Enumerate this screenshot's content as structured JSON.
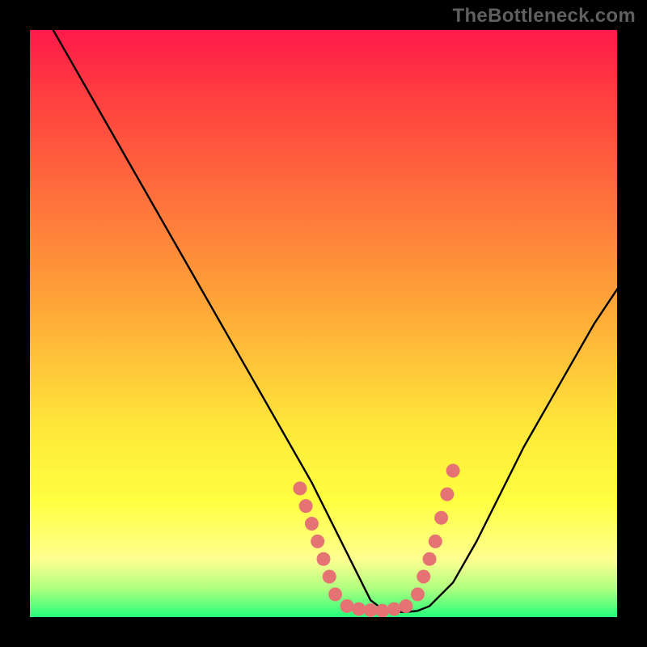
{
  "watermark": "TheBottleneck.com",
  "colors": {
    "background": "#000000",
    "gradient_top": "#ff194a",
    "gradient_red": "#ff4040",
    "gradient_orange": "#ffa038",
    "gradient_yellow_top": "#ffe83a",
    "gradient_yellow": "#ffff40",
    "gradient_pale_yellow": "#ffff90",
    "gradient_pale_green": "#b0ff80",
    "gradient_green": "#20ff7a",
    "curve": "#000000",
    "dots": "#e57373",
    "border": "#000000"
  },
  "chart_data": {
    "type": "line",
    "title": "",
    "xlabel": "",
    "ylabel": "",
    "xlim": [
      0,
      100
    ],
    "ylim": [
      0,
      100
    ],
    "series": [
      {
        "name": "bottleneck-curve",
        "x": [
          4,
          8,
          12,
          16,
          20,
          24,
          28,
          32,
          36,
          40,
          44,
          48,
          50,
          52,
          54,
          56,
          58,
          60,
          62,
          64,
          66,
          68,
          72,
          76,
          80,
          84,
          88,
          92,
          96,
          100
        ],
        "y": [
          100,
          93,
          86,
          79,
          72,
          65,
          58,
          51,
          44,
          37,
          30,
          23,
          19,
          15,
          11,
          7,
          3,
          1.5,
          1,
          1,
          1.2,
          2,
          6,
          13,
          21,
          29,
          36,
          43,
          50,
          56
        ]
      }
    ],
    "dots": {
      "left_cluster": {
        "x": [
          46,
          47,
          48,
          49,
          50,
          51,
          52
        ],
        "y": [
          22,
          19,
          16,
          13,
          10,
          7,
          4
        ]
      },
      "valley": {
        "x": [
          54,
          56,
          58,
          60,
          62,
          64
        ],
        "y": [
          2,
          1.5,
          1.3,
          1.2,
          1.5,
          2
        ]
      },
      "right_cluster": {
        "x": [
          66,
          67,
          68,
          69,
          70,
          71,
          72
        ],
        "y": [
          4,
          7,
          10,
          13,
          17,
          21,
          25
        ]
      }
    }
  }
}
